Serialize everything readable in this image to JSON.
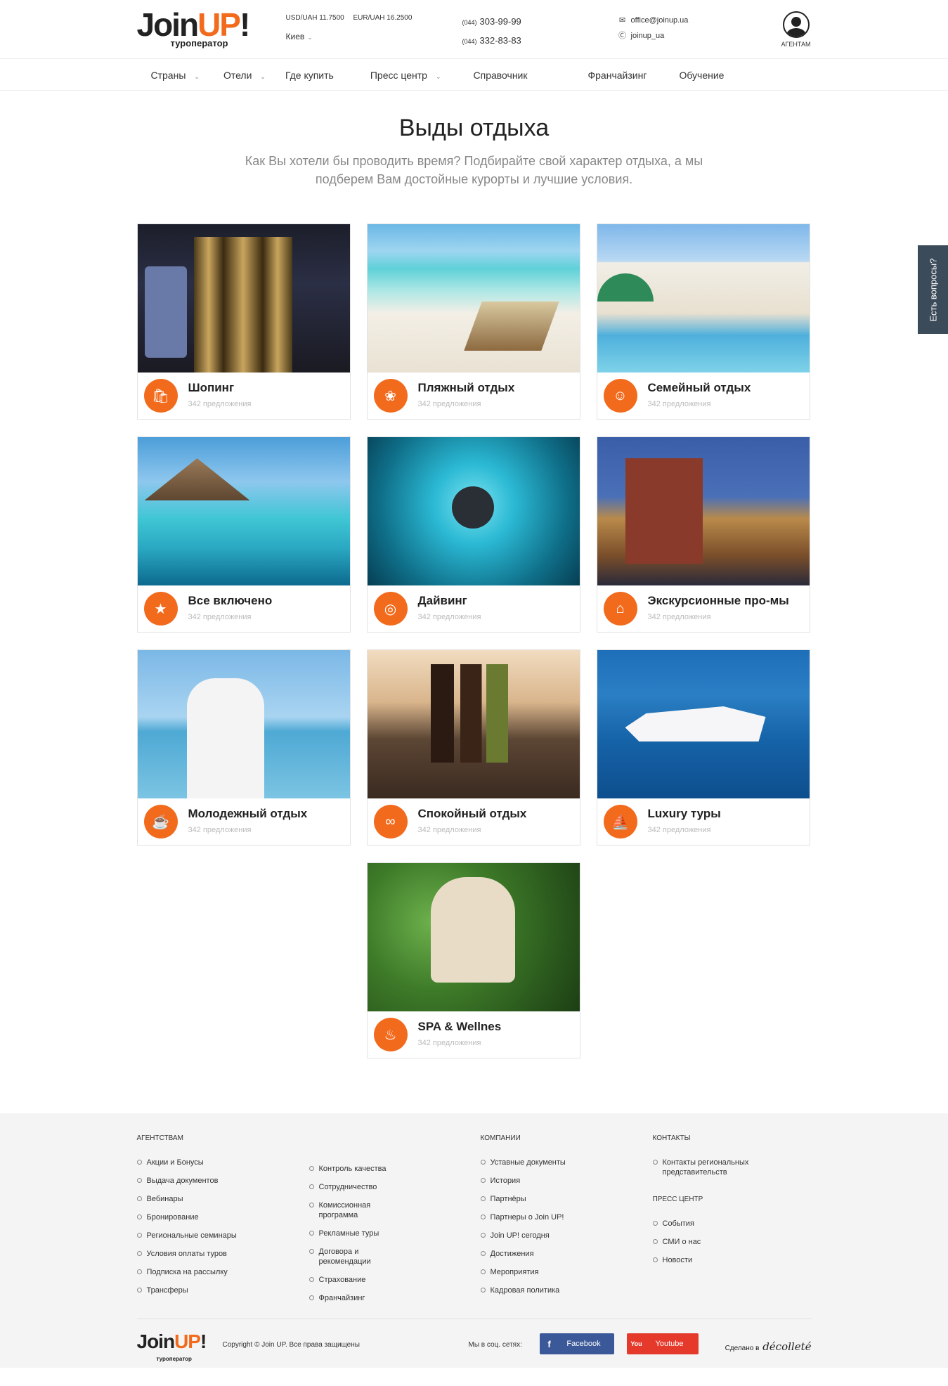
{
  "header": {
    "logo_word": "JoinUP!",
    "logo_join": "Join",
    "logo_up": "UP",
    "logo_bang": "!",
    "logo_sub": "туроператор",
    "rates": [
      "USD/UAH 11.7500",
      "EUR/UAH 16.2500"
    ],
    "city": "Киев",
    "phones": [
      {
        "code": "(044)",
        "number": "303-99-99"
      },
      {
        "code": "(044)",
        "number": "332-83-83"
      }
    ],
    "email": "office@joinup.ua",
    "skype": "joinup_ua",
    "agents_label": "АГЕНТАМ"
  },
  "nav": [
    {
      "label": "Страны",
      "dropdown": true
    },
    {
      "label": "Отели",
      "dropdown": true
    },
    {
      "label": "Где купить",
      "dropdown": false
    },
    {
      "label": "Пресс центр",
      "dropdown": true
    },
    {
      "label": "Справочник",
      "dropdown": false
    },
    {
      "label": "Франчайзинг",
      "dropdown": false
    },
    {
      "label": "Обучение",
      "dropdown": false
    }
  ],
  "hero": {
    "title": "Выды отдыха",
    "subtitle": "Как Вы хотели бы проводить время? Подбирайте свой характер отдыха, а мы подберем Вам достойные курорты и лучшие условия."
  },
  "cards": [
    {
      "title": "Шопинг",
      "count": "342 предложения",
      "icon": "shopping-bag-icon",
      "photo": "ph-shop"
    },
    {
      "title": "Пляжный отдых",
      "count": "342 предложения",
      "icon": "flip-flops-icon",
      "photo": "ph-beach"
    },
    {
      "title": "Семейный отдых",
      "count": "342 предложения",
      "icon": "family-icon",
      "photo": "ph-family"
    },
    {
      "title": "Все включено",
      "count": "342 предложения",
      "icon": "all-inclusive-stars-icon",
      "photo": "ph-all"
    },
    {
      "title": "Дайвинг",
      "count": "342 предложения",
      "icon": "diving-mask-icon",
      "photo": "ph-dive"
    },
    {
      "title": "Экскурсионные про-мы",
      "count": "342 предложения",
      "icon": "landmark-icon",
      "photo": "ph-excur"
    },
    {
      "title": "Молодежный отдых",
      "count": "342 предложения",
      "icon": "cocktail-icon",
      "photo": "ph-young"
    },
    {
      "title": "Спокойный отдых",
      "count": "342 предложения",
      "icon": "glasses-icon",
      "photo": "ph-calm"
    },
    {
      "title": "Luxury туры",
      "count": "342 предложения",
      "icon": "yacht-icon",
      "photo": "ph-lux"
    },
    {
      "title": "SPA & Wellnes",
      "count": "342 предложения",
      "icon": "spa-bowl-icon",
      "photo": "ph-spa"
    }
  ],
  "sidetab": "Есть вопросы?",
  "footer": {
    "agencies_title": "АГЕНТСТВАМ",
    "agencies_col1": [
      "Акции и Бонусы",
      "Выдача документов",
      "Вебинары",
      "Бронирование",
      "Региональные семинары",
      "Условия оплаты туров",
      "Подписка на рассылку",
      "Трансферы"
    ],
    "agencies_col2": [
      "Контроль качества",
      "Сотрудничество",
      "Комиссионная программа",
      "Рекламные туры",
      "Договора и рекомендации",
      "Страхование",
      "Франчайзинг"
    ],
    "company_title": "КОМПАНИИ",
    "company": [
      "Уставные документы",
      "История",
      "Партнёры",
      "Партнеры о Join UP!",
      "Join UP! сегодня",
      "Достижения",
      "Мероприятия",
      "Кадровая политика"
    ],
    "contacts_title": "КОНТАКТЫ",
    "contacts": [
      "Контакты региональных представительств"
    ],
    "press_title": "ПРЕСС ЦЕНТР",
    "press": [
      "События",
      "СМИ о нас",
      "Новости"
    ],
    "copyright": "Copyright © Join UP. Все права защищены",
    "social_label": "Мы в соц. сетях:",
    "facebook": "Facebook",
    "youtube": "Youtube",
    "youtube_badge": "You",
    "made_by_label": "Сделано в",
    "made_by_brand": "décolleté"
  },
  "colors": {
    "accent": "#f26b1d",
    "sidetab": "#3c4b5a",
    "facebook": "#3b5998",
    "youtube": "#e53a2b"
  }
}
